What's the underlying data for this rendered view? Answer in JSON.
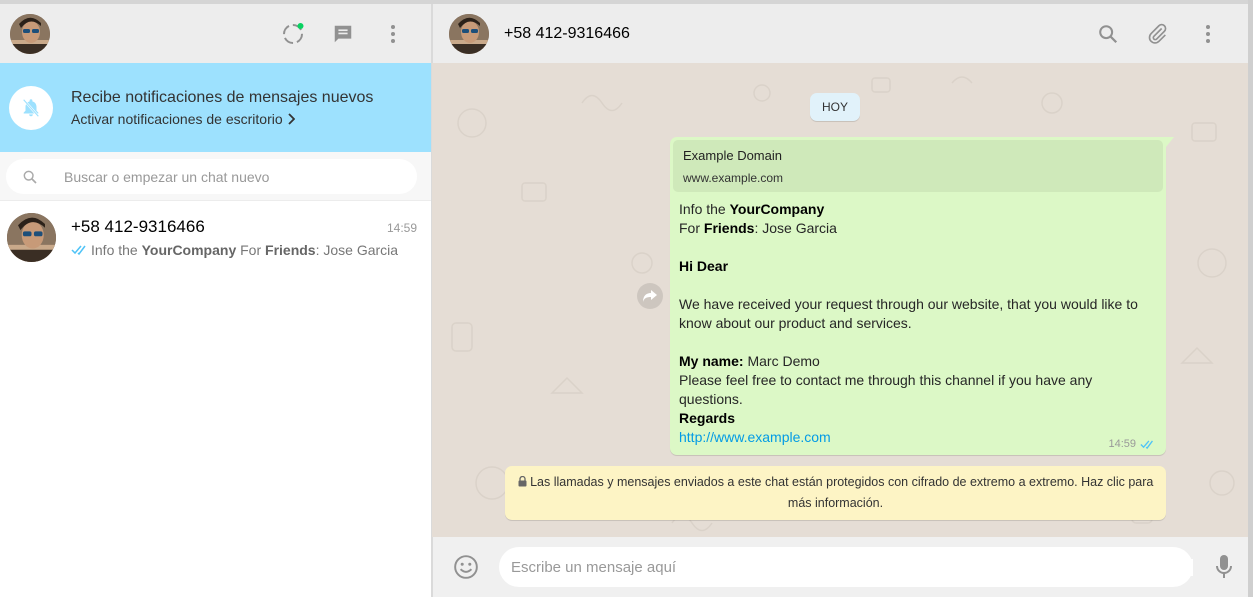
{
  "sidebar": {
    "notification": {
      "title": "Recibe notificaciones de mensajes nuevos",
      "link": "Activar notificaciones de escritorio"
    },
    "search": {
      "placeholder": "Buscar o empezar un chat nuevo"
    },
    "chats": [
      {
        "name": "+58 412-9316466",
        "time": "14:59",
        "preview_1": "Info the ",
        "preview_2": "YourCompany",
        "preview_3": " For ",
        "preview_4": "Friends",
        "preview_5": ":  Jose Garcia"
      }
    ]
  },
  "conversation": {
    "contact_name": "+58 412-9316466",
    "day_label": "HOY",
    "message": {
      "link_title": "Example Domain",
      "link_url": "www.example.com",
      "l1a": "Info the ",
      "l1b": "YourCompany",
      "l2a": "For ",
      "l2b": "Friends",
      "l2c": ":  Jose Garcia",
      "l3": "Hi Dear",
      "l4": "We have received your request through our website, that you would like to know about our product and services.",
      "l5a": "My name:",
      "l5b": " Marc Demo",
      "l6": "Please feel free to contact me through this channel if you have any questions.",
      "l7": "Regards",
      "link": "http://www.example.com",
      "time": "14:59"
    },
    "encryption_notice": "Las llamadas y mensajes enviados a este chat están protegidos con cifrado de extremo a extremo. Haz clic para más información."
  },
  "composer": {
    "placeholder": "Escribe un mensaje aquí"
  },
  "colors": {
    "notify_bg": "#9de1fe",
    "outgoing_bubble": "#dcf8c6",
    "ticks_read": "#4fc3f7",
    "link": "#039be5"
  }
}
